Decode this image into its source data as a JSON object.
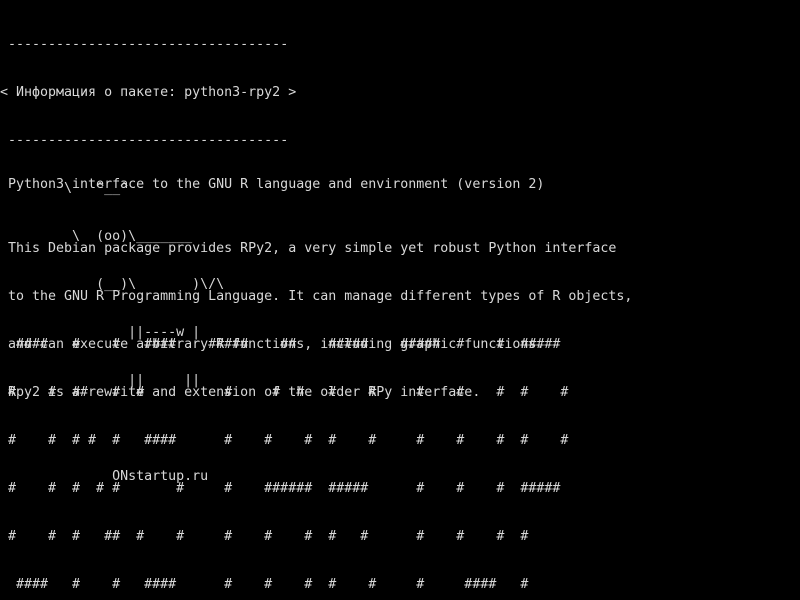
{
  "terminal": {
    "background": "#000000",
    "foreground": "#d8d8d8"
  },
  "cowsay": {
    "top_border": " -----------------------------------",
    "title_line": "< Информация о пакете: python3-rpy2 >",
    "bottom_border": " -----------------------------------",
    "cow": [
      "        \\   ^__^",
      "         \\  (oo)\\_______",
      "            (__)\\       )\\/\\",
      "                ||----w |",
      "                ||     ||"
    ],
    "site": "              ONstartup.ru"
  },
  "package": {
    "summary": "Python3 interface to the GNU R language and environment (version 2)",
    "description": [
      "This Debian package provides RPy2, a very simple yet robust Python interface",
      "to the GNU R Programming Language. It can manage different types of R objects,",
      "and can execute arbitrary R functions, including graphic functions.",
      "Rpy2 is a rewrite and extension of the older RPy interface."
    ]
  },
  "banner": {
    "lines": [
      " ####   #    #   ####    #####    ##    #####    #####  #    #  #####",
      "#    #  ##   #  #          #     #  #   #    #     #    #    #  #    #",
      "#    #  # #  #   ####      #    #    #  #    #     #    #    #  #    #",
      "#    #  #  # #       #     #    ######  #####      #    #    #  #####",
      "#    #  #   ##  #    #     #    #    #  #   #      #    #    #  #",
      " ####   #    #   ####      #    #    #  #    #     #     ####   #"
    ]
  }
}
